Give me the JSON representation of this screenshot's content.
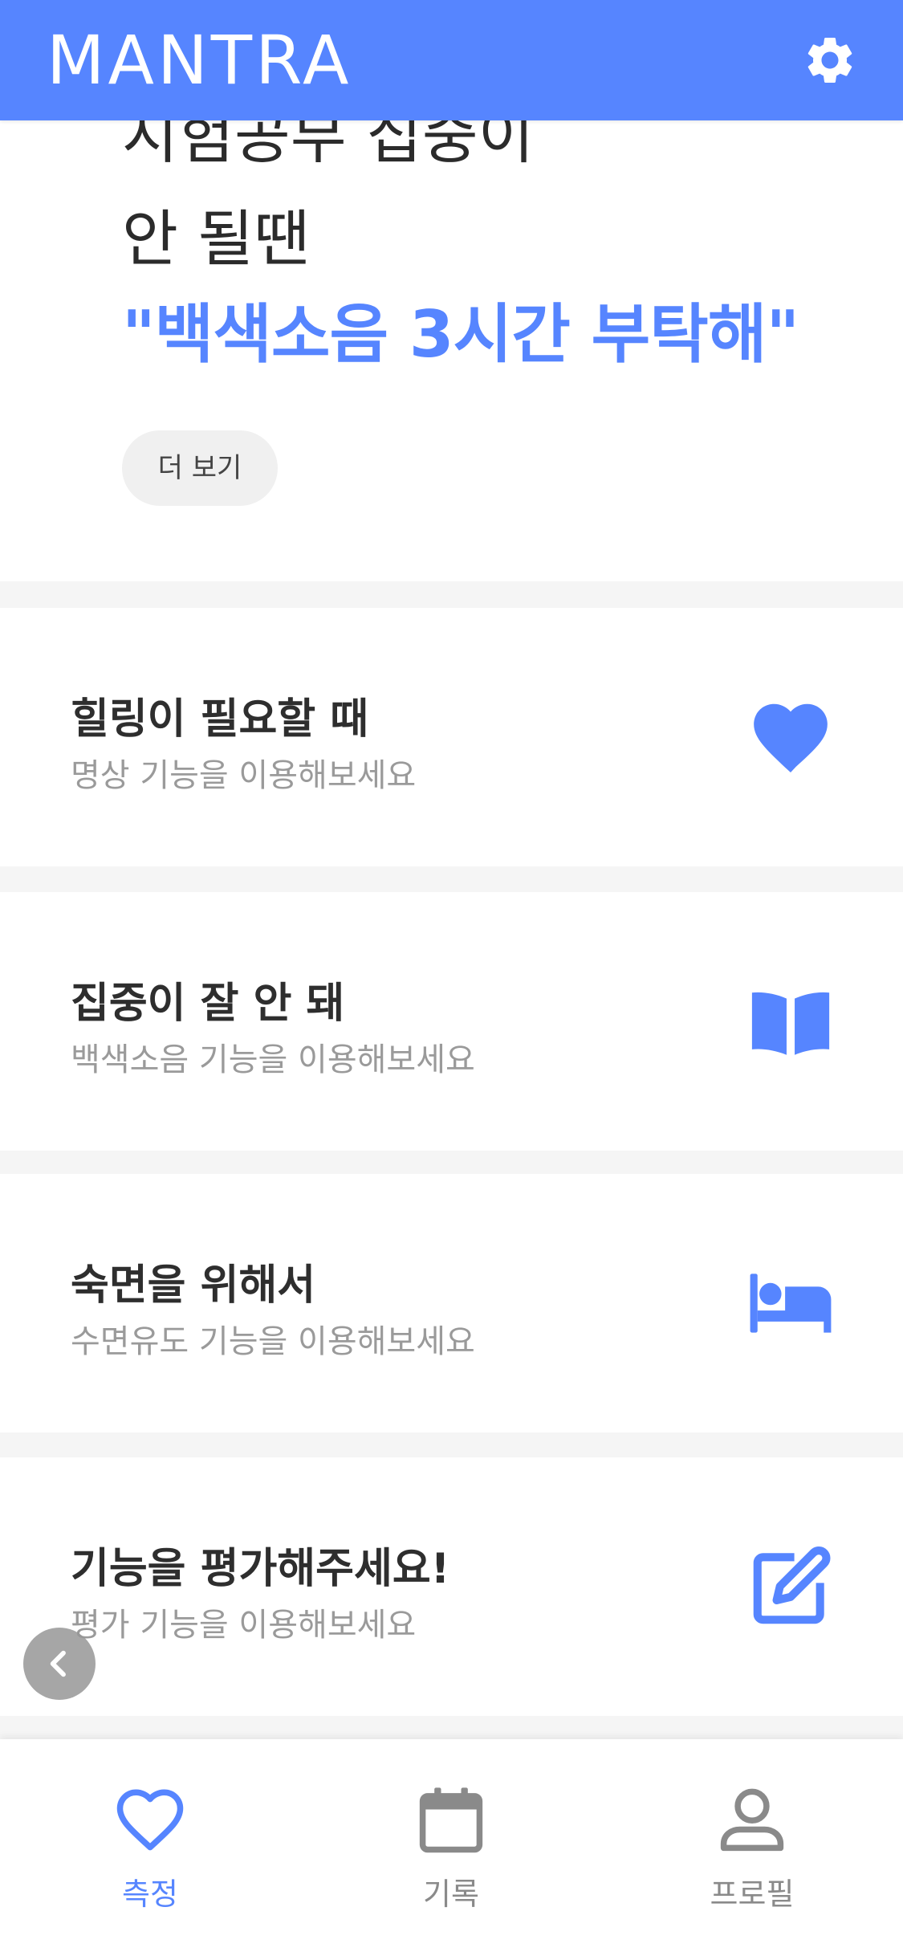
{
  "header": {
    "logo_text": "MANTRA",
    "icons": {
      "settings": "gear-icon"
    }
  },
  "hero": {
    "line1": "시험공부 집중이",
    "line2": "안 될땐",
    "quote": "\"백색소음 3시간 부탁해\"",
    "more_label": "더 보기"
  },
  "features": [
    {
      "title": "힐링이 필요할 때",
      "subtitle": "명상 기능을 이용해보세요",
      "icon": "heart-icon"
    },
    {
      "title": "집중이 잘 안 돼",
      "subtitle": "백색소음 기능을 이용해보세요",
      "icon": "book-icon"
    },
    {
      "title": "숙면을 위해서",
      "subtitle": "수면유도 기능을 이용해보세요",
      "icon": "bed-icon"
    },
    {
      "title": "기능을 평가해주세요!",
      "subtitle": "평가 기능을 이용해보세요",
      "icon": "edit-icon"
    }
  ],
  "back_button": {
    "icon": "chevron-left-icon"
  },
  "bottom_nav": {
    "active_index": 0,
    "items": [
      {
        "label": "측정",
        "icon": "heart-outline-icon"
      },
      {
        "label": "기록",
        "icon": "calendar-icon"
      },
      {
        "label": "프로필",
        "icon": "user-icon"
      }
    ]
  },
  "colors": {
    "accent": "#5685ff",
    "title_text": "#2e2e2e",
    "subtitle_text": "#9a9a9a",
    "inactive_nav": "#8a8a8a",
    "background": "#f5f5f5"
  }
}
